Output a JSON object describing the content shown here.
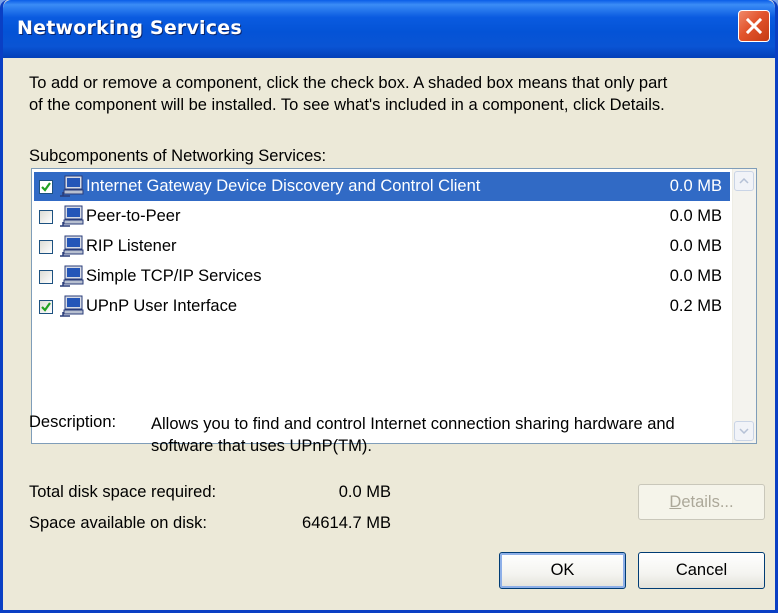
{
  "window": {
    "title": "Networking Services"
  },
  "intro": {
    "line1": "To add or remove a component, click the check box. A shaded box means that only part",
    "line2": "of the component will be installed. To see what's included in a component, click Details."
  },
  "subcomponents": {
    "label_pre": "Sub",
    "label_accel": "c",
    "label_post": "omponents of Networking Services:",
    "items": [
      {
        "label": "Internet Gateway Device Discovery and Control Client",
        "size": "0.0 MB",
        "checked": true,
        "selected": true,
        "icon": "network-computer-icon"
      },
      {
        "label": "Peer-to-Peer",
        "size": "0.0 MB",
        "checked": false,
        "selected": false,
        "icon": "network-computer-icon"
      },
      {
        "label": "RIP Listener",
        "size": "0.0 MB",
        "checked": false,
        "selected": false,
        "icon": "network-computer-icon"
      },
      {
        "label": "Simple TCP/IP Services",
        "size": "0.0 MB",
        "checked": false,
        "selected": false,
        "icon": "network-computer-icon"
      },
      {
        "label": "UPnP User Interface",
        "size": "0.2 MB",
        "checked": true,
        "selected": false,
        "icon": "network-computer-icon"
      }
    ]
  },
  "description": {
    "label": "Description:",
    "line1": "Allows you to find and control Internet connection sharing hardware and",
    "line2": "software that uses UPnP(TM)."
  },
  "disk": {
    "required_label": "Total disk space required:",
    "required_value": "0.0 MB",
    "available_label": "Space available on disk:",
    "available_value": "64614.7 MB"
  },
  "buttons": {
    "details_accel": "D",
    "details_rest": "etails...",
    "ok": "OK",
    "cancel": "Cancel"
  },
  "colors": {
    "titlebar": "#0453d6",
    "selection": "#316ac5",
    "dialog_bg": "#ece9d8",
    "close_button": "#e2542c"
  }
}
